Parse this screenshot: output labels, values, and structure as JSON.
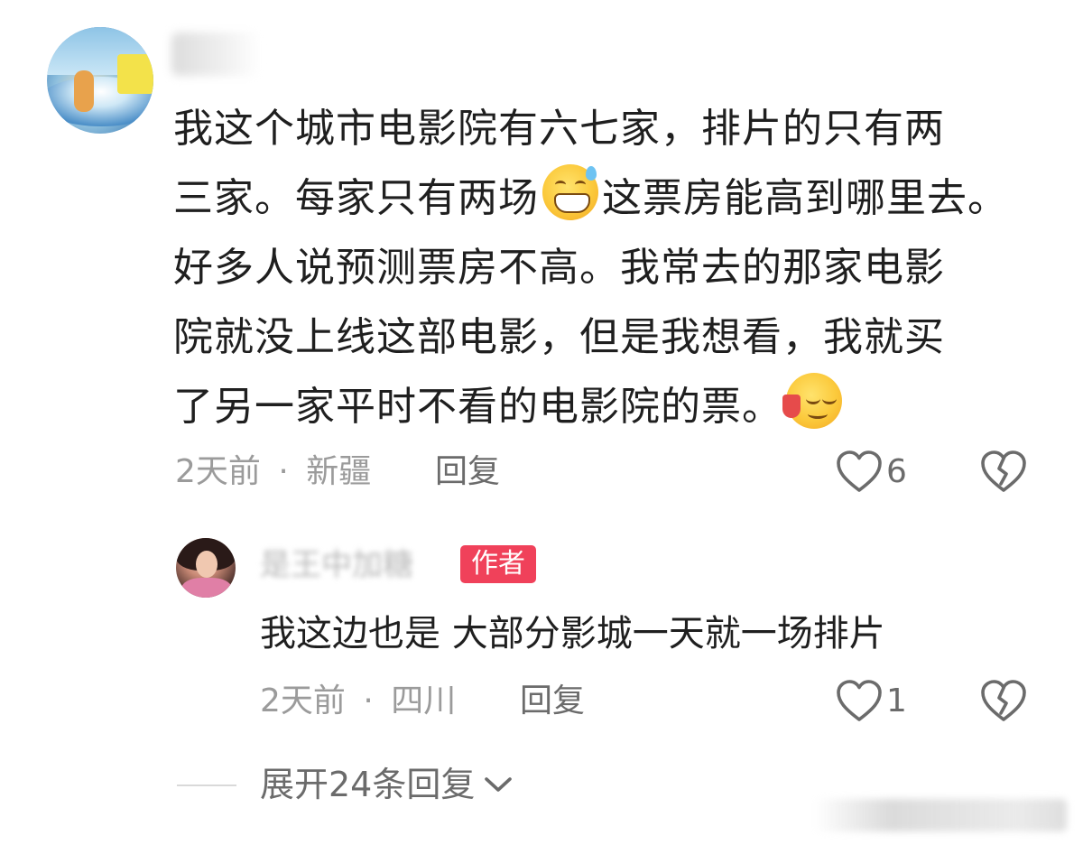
{
  "main_comment": {
    "username": "",
    "lines": [
      "我这个城市电影院有六七家，排片的只有两",
      "三家。每家只有两场",
      "这票房能高到哪里去。",
      "好多人说预测票房不高。我常去的那家电影",
      "院就没上线这部电影，但是我想看，我就买",
      "了另一家平时不看的电影院的票。"
    ],
    "emoji_1": "grimace-sweat-emoji",
    "emoji_2": "smirk-wine-emoji",
    "time": "2天前",
    "separator": "·",
    "location": "新疆",
    "reply_label": "回复",
    "like_count": "6"
  },
  "reply": {
    "username": "是王中加糖",
    "author_badge": "作者",
    "text": "我这边也是 大部分影城一天就一场排片",
    "time": "2天前",
    "separator": "·",
    "location": "四川",
    "reply_label": "回复",
    "like_count": "1"
  },
  "expand": {
    "label": "展开24条回复"
  },
  "colors": {
    "badge": "#f0415a",
    "meta_text": "#9b9b9b",
    "body_text": "#1f1f1f",
    "icon": "#6b6b6b"
  }
}
